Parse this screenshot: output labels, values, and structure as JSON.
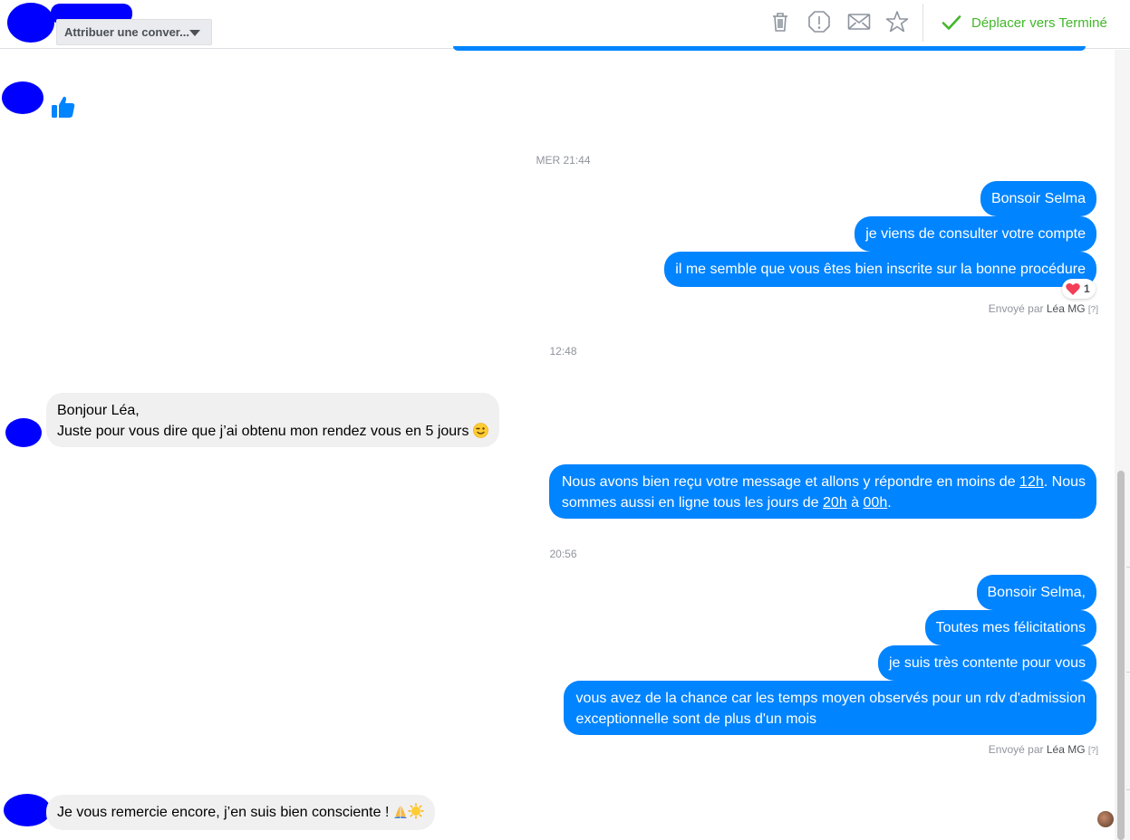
{
  "header": {
    "assign_label": "Attribuer une conver...",
    "move_done_label": "Déplacer vers Terminé",
    "icons": [
      "trash-icon",
      "report-icon",
      "mail-icon",
      "star-icon",
      "check-icon"
    ],
    "colors": {
      "accent_green": "#42b72a",
      "outgoing_bubble": "#0084ff",
      "incoming_bubble": "#f1f0f0"
    }
  },
  "conversation": {
    "time1": "MER 21:44",
    "time2": "12:48",
    "time3": "20:56",
    "block1": {
      "m1": "Bonsoir Selma",
      "m2": "je viens de consulter votre compte",
      "m3": "il me semble que vous êtes bien inscrite sur la bonne procédure",
      "reaction_count": "1",
      "sent_prefix": "Envoyé par",
      "sent_name": "Léa MG",
      "sent_help": "[?]"
    },
    "incoming1": {
      "line1": "Bonjour Léa,",
      "line2": "Juste pour vous dire que j’ai obtenu mon rendez vous en 5 jours"
    },
    "auto_reply": {
      "part1": "Nous avons bien reçu votre message et allons y répondre en moins de ",
      "link1": "12h",
      "part2": ". Nous",
      "part3": "sommes aussi en ligne tous les jours de ",
      "link2": "20h",
      "part4": " à ",
      "link3": "00h",
      "part5": "."
    },
    "block2": {
      "m1": "Bonsoir Selma,",
      "m2": "Toutes mes félicitations",
      "m3": "je suis très contente pour vous",
      "m4_line1": "vous avez de la chance car les temps moyen observés pour un rdv d'admission",
      "m4_line2": "exceptionnelle sont de plus d'un mois",
      "sent_prefix": "Envoyé par",
      "sent_name": "Léa MG",
      "sent_help": "[?]"
    },
    "incoming2": {
      "text": "Je vous remercie encore, j’en suis bien consciente ! "
    }
  }
}
